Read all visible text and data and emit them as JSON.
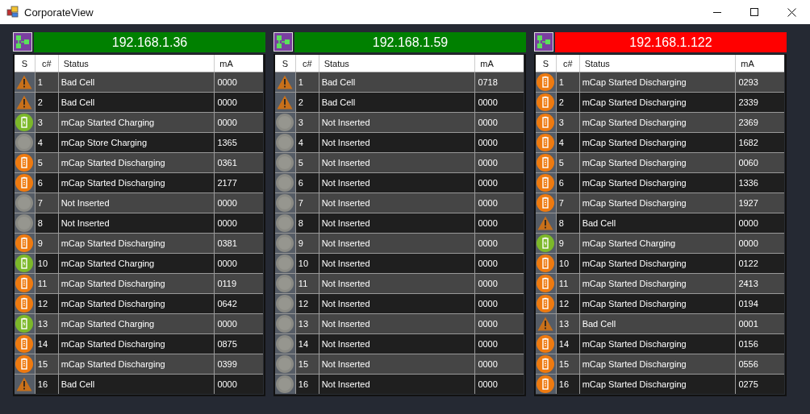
{
  "window": {
    "title": "CorporateView"
  },
  "panels": [
    {
      "address": "192.168.1.36",
      "color": "#008000",
      "columns": [
        "S",
        "c#",
        "Status",
        "mA"
      ],
      "rows": [
        {
          "kind": "warning",
          "cell": "1",
          "status": "Bad Cell",
          "ma": "0000"
        },
        {
          "kind": "warning",
          "cell": "2",
          "status": "Bad Cell",
          "ma": "0000"
        },
        {
          "kind": "charging",
          "cell": "3",
          "status": "mCap Started Charging",
          "ma": "0000"
        },
        {
          "kind": "idle",
          "cell": "4",
          "status": "mCap Store Charging",
          "ma": "1365"
        },
        {
          "kind": "discharging",
          "cell": "5",
          "status": "mCap Started Discharging",
          "ma": "0361"
        },
        {
          "kind": "discharging",
          "cell": "6",
          "status": "mCap Started Discharging",
          "ma": "2177"
        },
        {
          "kind": "idle",
          "cell": "7",
          "status": "Not Inserted",
          "ma": "0000"
        },
        {
          "kind": "idle",
          "cell": "8",
          "status": "Not Inserted",
          "ma": "0000"
        },
        {
          "kind": "discharging",
          "cell": "9",
          "status": "mCap Started Discharging",
          "ma": "0381"
        },
        {
          "kind": "charging",
          "cell": "10",
          "status": "mCap Started Charging",
          "ma": "0000"
        },
        {
          "kind": "discharging",
          "cell": "11",
          "status": "mCap Started Discharging",
          "ma": "0119"
        },
        {
          "kind": "discharging",
          "cell": "12",
          "status": "mCap Started Discharging",
          "ma": "0642"
        },
        {
          "kind": "charging",
          "cell": "13",
          "status": "mCap Started Charging",
          "ma": "0000"
        },
        {
          "kind": "discharging",
          "cell": "14",
          "status": "mCap Started Discharging",
          "ma": "0875"
        },
        {
          "kind": "discharging",
          "cell": "15",
          "status": "mCap Started Discharging",
          "ma": "0399"
        },
        {
          "kind": "warning",
          "cell": "16",
          "status": "Bad Cell",
          "ma": "0000"
        }
      ]
    },
    {
      "address": "192.168.1.59",
      "color": "#008000",
      "columns": [
        "S",
        "c#",
        "Status",
        "mA"
      ],
      "rows": [
        {
          "kind": "warning",
          "cell": "1",
          "status": "Bad Cell",
          "ma": "0718"
        },
        {
          "kind": "warning",
          "cell": "2",
          "status": "Bad Cell",
          "ma": "0000"
        },
        {
          "kind": "idle",
          "cell": "3",
          "status": "Not Inserted",
          "ma": "0000"
        },
        {
          "kind": "idle",
          "cell": "4",
          "status": "Not Inserted",
          "ma": "0000"
        },
        {
          "kind": "idle",
          "cell": "5",
          "status": "Not Inserted",
          "ma": "0000"
        },
        {
          "kind": "idle",
          "cell": "6",
          "status": "Not Inserted",
          "ma": "0000"
        },
        {
          "kind": "idle",
          "cell": "7",
          "status": "Not Inserted",
          "ma": "0000"
        },
        {
          "kind": "idle",
          "cell": "8",
          "status": "Not Inserted",
          "ma": "0000"
        },
        {
          "kind": "idle",
          "cell": "9",
          "status": "Not Inserted",
          "ma": "0000"
        },
        {
          "kind": "idle",
          "cell": "10",
          "status": "Not Inserted",
          "ma": "0000"
        },
        {
          "kind": "idle",
          "cell": "11",
          "status": "Not Inserted",
          "ma": "0000"
        },
        {
          "kind": "idle",
          "cell": "12",
          "status": "Not Inserted",
          "ma": "0000"
        },
        {
          "kind": "idle",
          "cell": "13",
          "status": "Not Inserted",
          "ma": "0000"
        },
        {
          "kind": "idle",
          "cell": "14",
          "status": "Not Inserted",
          "ma": "0000"
        },
        {
          "kind": "idle",
          "cell": "15",
          "status": "Not Inserted",
          "ma": "0000"
        },
        {
          "kind": "idle",
          "cell": "16",
          "status": "Not Inserted",
          "ma": "0000"
        }
      ]
    },
    {
      "address": "192.168.1.122",
      "color": "#ff0000",
      "columns": [
        "S",
        "c#",
        "Status",
        "mA"
      ],
      "rows": [
        {
          "kind": "discharging",
          "cell": "1",
          "status": "mCap Started Discharging",
          "ma": "0293"
        },
        {
          "kind": "discharging",
          "cell": "2",
          "status": "mCap Started Discharging",
          "ma": "2339"
        },
        {
          "kind": "discharging",
          "cell": "3",
          "status": "mCap Started Discharging",
          "ma": "2369"
        },
        {
          "kind": "discharging",
          "cell": "4",
          "status": "mCap Started Discharging",
          "ma": "1682"
        },
        {
          "kind": "discharging",
          "cell": "5",
          "status": "mCap Started Discharging",
          "ma": "0060"
        },
        {
          "kind": "discharging",
          "cell": "6",
          "status": "mCap Started Discharging",
          "ma": "1336"
        },
        {
          "kind": "discharging",
          "cell": "7",
          "status": "mCap Started Discharging",
          "ma": "1927"
        },
        {
          "kind": "warning",
          "cell": "8",
          "status": "Bad Cell",
          "ma": "0000"
        },
        {
          "kind": "charging",
          "cell": "9",
          "status": "mCap Started Charging",
          "ma": "0000"
        },
        {
          "kind": "discharging",
          "cell": "10",
          "status": "mCap Started Discharging",
          "ma": "0122"
        },
        {
          "kind": "discharging",
          "cell": "11",
          "status": "mCap Started Discharging",
          "ma": "2413"
        },
        {
          "kind": "discharging",
          "cell": "12",
          "status": "mCap Started Discharging",
          "ma": "0194"
        },
        {
          "kind": "warning",
          "cell": "13",
          "status": "Bad Cell",
          "ma": "0001"
        },
        {
          "kind": "discharging",
          "cell": "14",
          "status": "mCap Started Discharging",
          "ma": "0156"
        },
        {
          "kind": "discharging",
          "cell": "15",
          "status": "mCap Started Discharging",
          "ma": "0556"
        },
        {
          "kind": "discharging",
          "cell": "16",
          "status": "mCap Started Discharging",
          "ma": "0275"
        }
      ]
    }
  ]
}
